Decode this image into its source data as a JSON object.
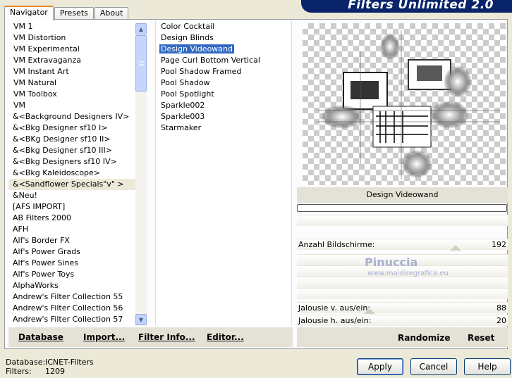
{
  "app": {
    "title": "Filters Unlimited 2.0"
  },
  "tabs": [
    {
      "label": "Navigator",
      "active": true
    },
    {
      "label": "Presets",
      "active": false
    },
    {
      "label": "About",
      "active": false
    }
  ],
  "categories": [
    "VM 1",
    "VM Distortion",
    "VM Experimental",
    "VM Extravaganza",
    "VM Instant Art",
    "VM Natural",
    "VM Toolbox",
    "VM",
    "&<Background Designers IV>",
    "&<Bkg Designer sf10 I>",
    "&<BKg Designer sf10 II>",
    "&<Bkg Designer sf10 III>",
    "&<Bkg Designers sf10 IV>",
    "&<Bkg Kaleidoscope>",
    "&<Sandflower Specials\"v\" >",
    "&Neu!",
    "[AFS IMPORT]",
    "AB Filters 2000",
    "AFH",
    "Alf's Border FX",
    "Alf's Power Grads",
    "Alf's Power Sines",
    "Alf's Power Toys",
    "AlphaWorks",
    "Andrew's Filter Collection 55",
    "Andrew's Filter Collection 56",
    "Andrew's Filter Collection 57"
  ],
  "selected_category": "&<Sandflower Specials\"v\" >",
  "filters": [
    "Color Cocktail",
    "Design Blinds",
    "Design Videowand",
    "Page Curl Bottom Vertical",
    "Pool Shadow Framed",
    "Pool Shadow",
    "Pool Spotlight",
    "Sparkle002",
    "Sparkle003",
    "Starmaker"
  ],
  "selected_filter": "Design Videowand",
  "preview": {
    "filter_name": "Design Videowand"
  },
  "params": [
    {
      "label": "Anzahl Bildschirme:",
      "value": "192"
    },
    {
      "label": "Jalousie v. aus/ein:",
      "value": "88"
    },
    {
      "label": "Jalousie h. aus/ein:",
      "value": "20"
    }
  ],
  "watermark": {
    "name": "Pinuccia",
    "url": "www.maidiregrafica.eu"
  },
  "left_buttons": {
    "database": "Database",
    "import": "Import...",
    "filter_info": "Filter Info...",
    "editor": "Editor..."
  },
  "right_buttons": {
    "randomize": "Randomize",
    "reset": "Reset"
  },
  "status": {
    "database_label": "Database:",
    "database_value": "ICNET-Filters",
    "filters_label": "Filters:",
    "filters_value": "1209"
  },
  "dialog_buttons": {
    "apply": "Apply",
    "cancel": "Cancel",
    "help": "Help"
  }
}
